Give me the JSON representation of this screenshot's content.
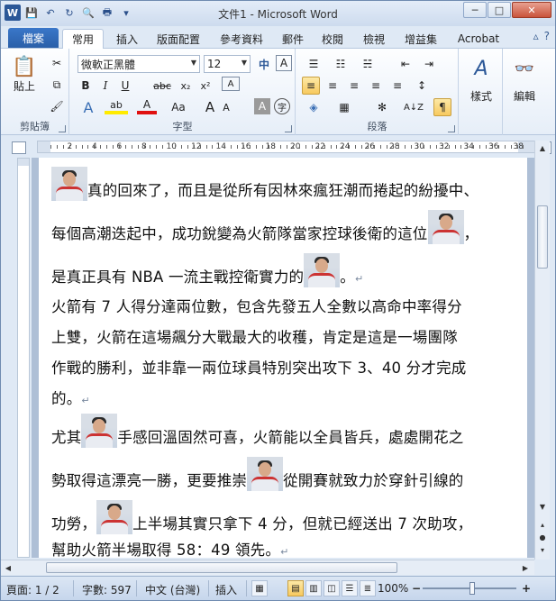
{
  "window": {
    "title": "文件1 - Microsoft Word",
    "minimize": "─",
    "maximize": "□",
    "close": "✕"
  },
  "qat": {
    "logo": "W",
    "save": "💾",
    "undo": "↶",
    "redo": "↻",
    "print_preview": "🔍",
    "quick_print": "🖶",
    "more": "▾"
  },
  "tabs": {
    "file": "檔案",
    "items": [
      "常用",
      "插入",
      "版面配置",
      "參考資料",
      "郵件",
      "校閱",
      "檢視",
      "增益集",
      "Acrobat"
    ],
    "help": "?",
    "collapse": "▵"
  },
  "ribbon": {
    "clipboard": {
      "label": "剪貼簿",
      "paste": "貼上",
      "cut": "✂",
      "copy": "⧉",
      "painter": "🖌"
    },
    "font": {
      "label": "字型",
      "font_name": "微軟正黑體",
      "font_size": "12",
      "bold": "B",
      "italic": "I",
      "underline": "U",
      "strike": "abc",
      "subscript": "x₂",
      "superscript": "x²",
      "grow": "A",
      "shrink": "A",
      "case": "Aa",
      "clear": "A",
      "phonetic": "中",
      "highlight": "ab",
      "color": "A",
      "box": "A",
      "circle": "字",
      "effects": "A"
    },
    "paragraph": {
      "label": "段落",
      "bullets": "☰",
      "numbering": "☷",
      "multilevel": "☵",
      "dec_indent": "⇤",
      "inc_indent": "⇥",
      "align_left": "≡",
      "center": "≡",
      "right": "≡",
      "justify": "≡",
      "distributed": "≡",
      "spacing": "↕",
      "shading": "◈",
      "border": "▦",
      "sort": "A↓Z",
      "show_marks": "¶",
      "asian": "✻"
    },
    "styles": {
      "label": "樣式"
    },
    "editing": {
      "label": "編輯"
    }
  },
  "ruler": {
    "numbers": [
      "2",
      "4",
      "6",
      "8",
      "10",
      "12",
      "14",
      "16",
      "18",
      "20",
      "22",
      "24",
      "26",
      "28",
      "30",
      "32",
      "34",
      "36",
      "38"
    ]
  },
  "document": {
    "lines": [
      {
        "before": "",
        "after": "真的回來了，而且是從所有因林來瘋狂潮而捲起的紛擾中、",
        "img": true,
        "mark": false
      },
      {
        "before": "每個高潮迭起中，成功銳變為火箭隊當家控球後衛的這位",
        "after": "，",
        "img": true,
        "mark": false
      },
      {
        "before": "是真正具有 NBA 一流主戰控衛實力的",
        "after": "。",
        "img": true,
        "mark": true
      },
      {
        "before": "火箭有 7 人得分達兩位數，包含先發五人全數以高命中率得分",
        "after": "",
        "img": false,
        "mark": false
      },
      {
        "before": "上雙，火箭在這場飆分大戰最大的收穫，肯定是這是一場團隊",
        "after": "",
        "img": false,
        "mark": false
      },
      {
        "before": "作戰的勝利，並非靠一兩位球員特別突出攻下 3、40 分才完成",
        "after": "",
        "img": false,
        "mark": false
      },
      {
        "before": "的。",
        "after": "",
        "img": false,
        "mark": true
      },
      {
        "before": "尤其",
        "after": "手感回溫固然可喜，火箭能以全員皆兵，處處開花之",
        "img": true,
        "mark": false
      },
      {
        "before": "勢取得這漂亮一勝，更要推崇",
        "after": "從開賽就致力於穿針引線的",
        "img": true,
        "mark": false
      },
      {
        "before": "功勞，",
        "after": "上半場其實只拿下 4 分，但就已經送出 7 次助攻，",
        "img": true,
        "mark": false
      },
      {
        "before": "幫助火箭半場取得 58：49 領先。",
        "after": "",
        "img": false,
        "mark": true
      }
    ],
    "para_mark": "↵"
  },
  "statusbar": {
    "page": "頁面: 1 / 2",
    "words": "字數: 597",
    "language": "中文 (台灣)",
    "mode": "插入",
    "zoom": "100%",
    "zoom_level": 1.0,
    "minus": "−",
    "plus": "+"
  }
}
